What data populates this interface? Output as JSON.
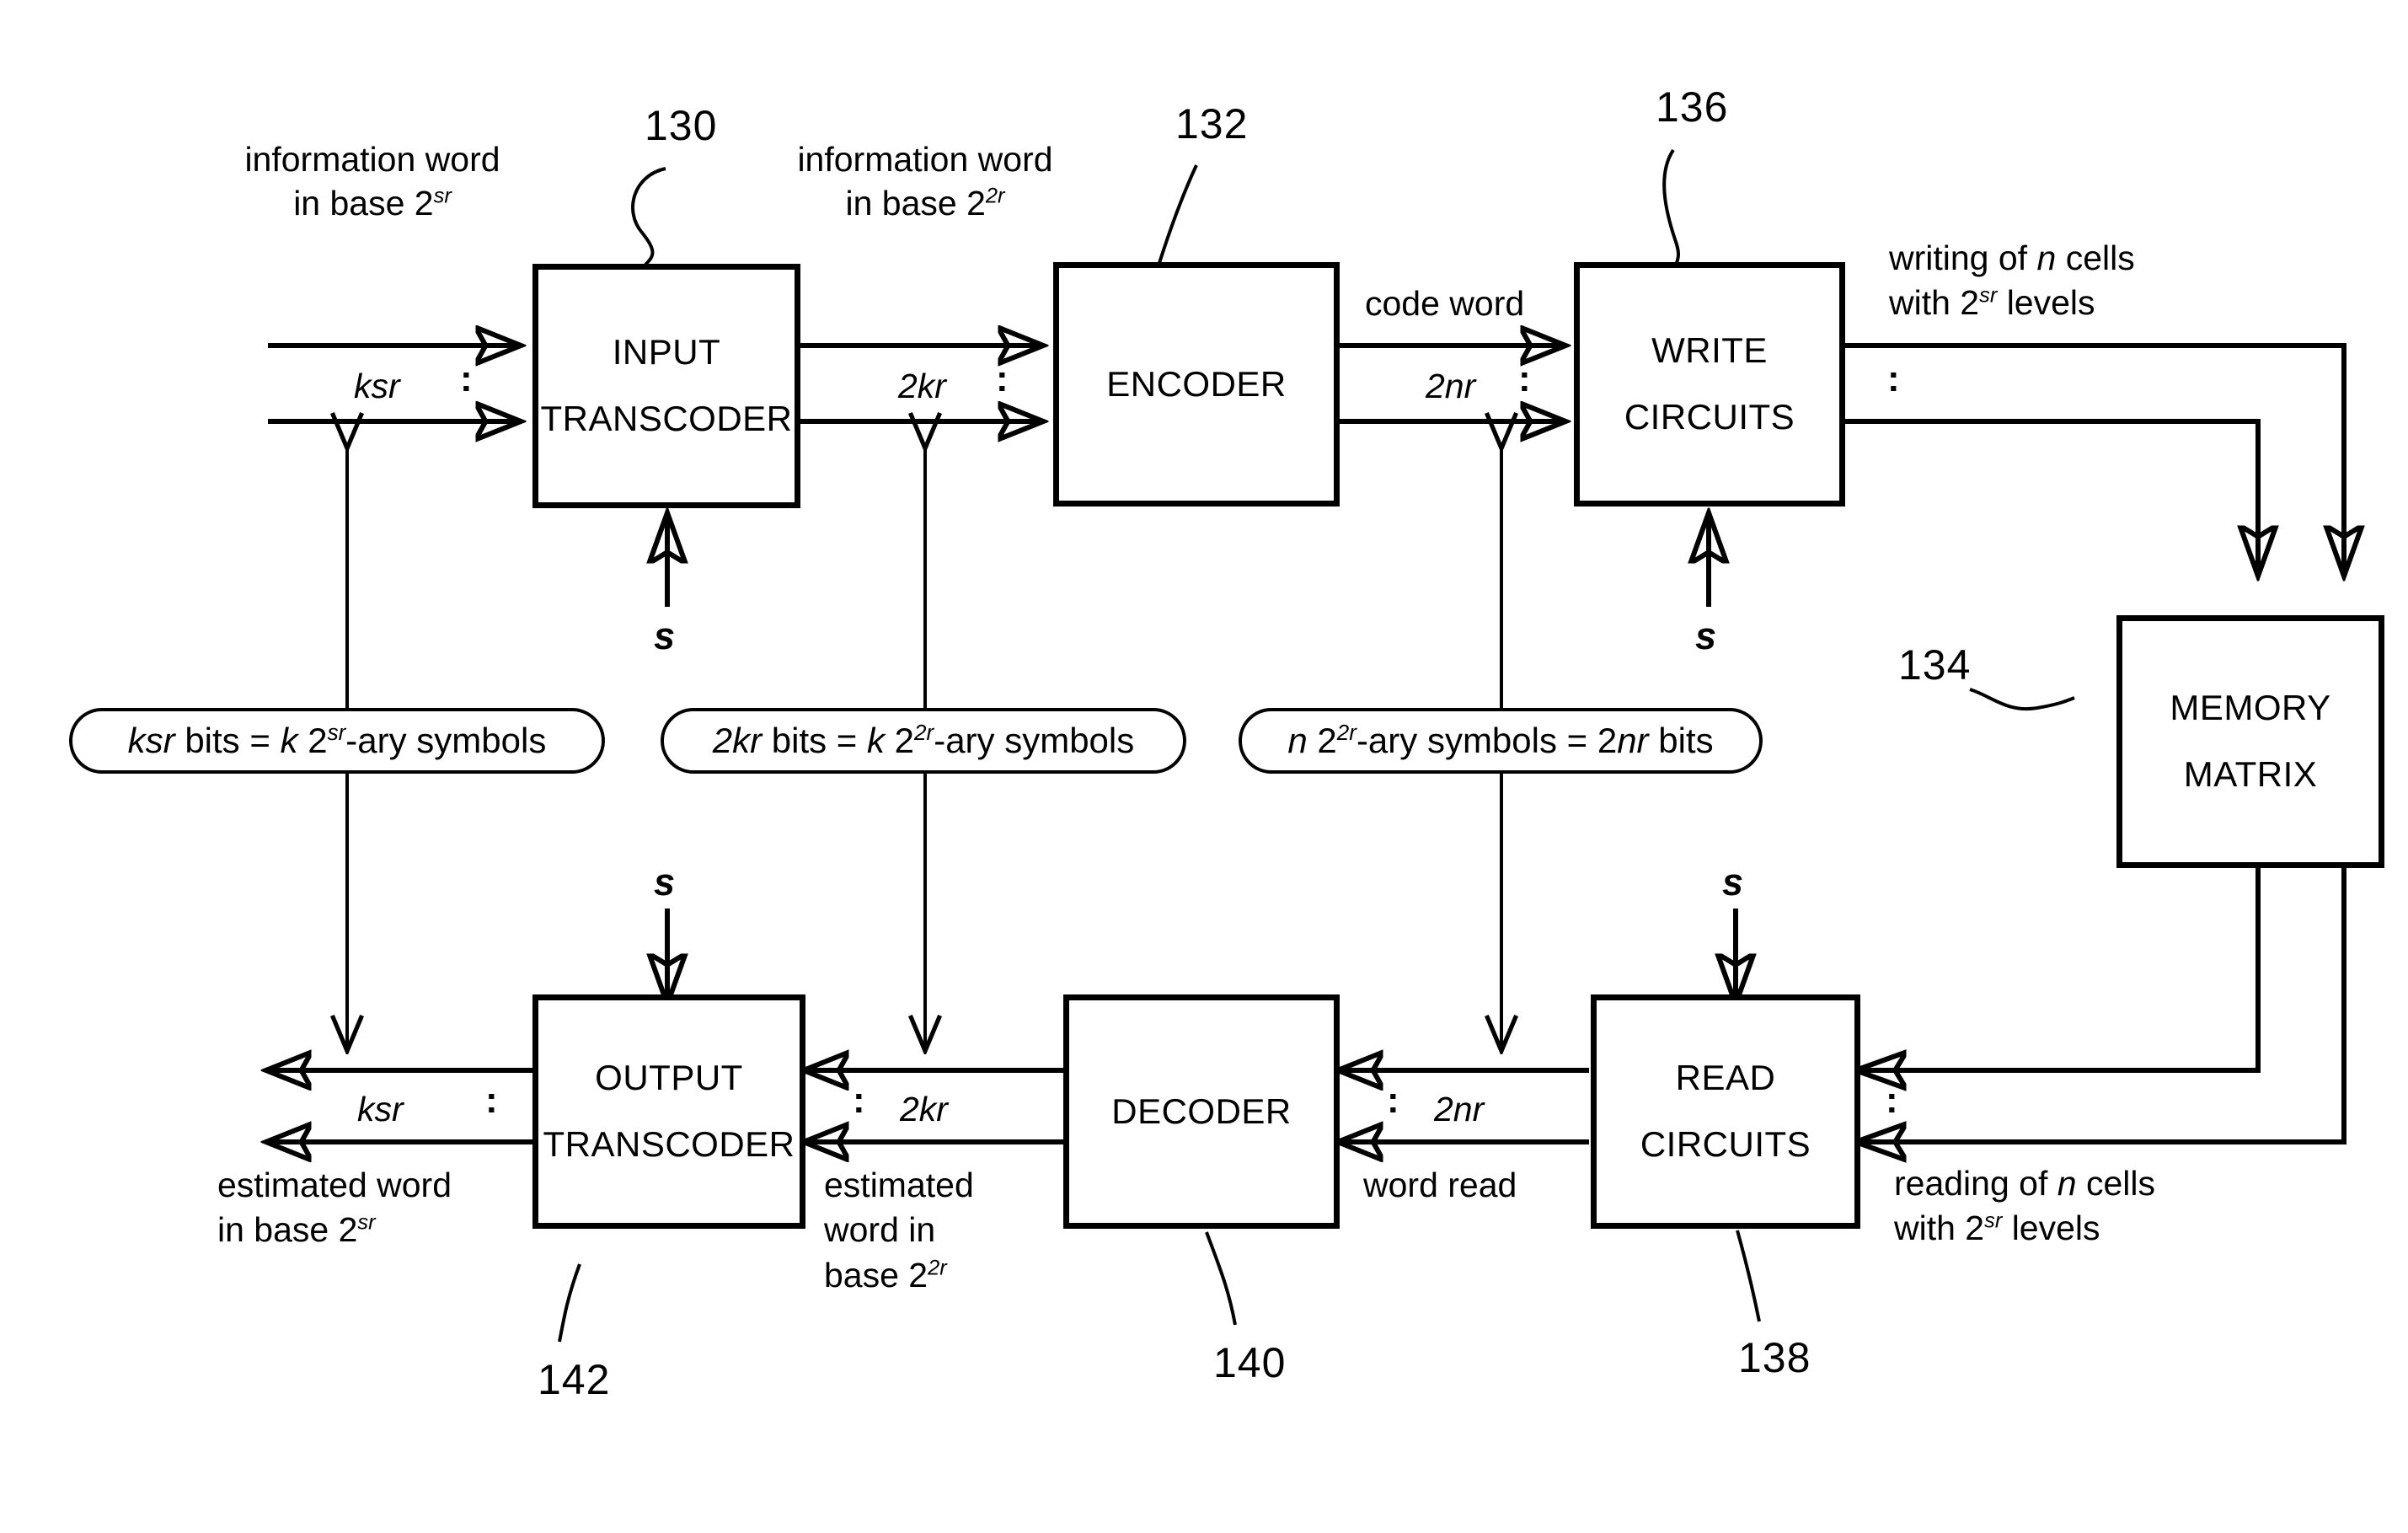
{
  "figure": {
    "type": "block-diagram",
    "title": "Memory coding/decoding block diagram"
  },
  "blocks": [
    {
      "id": "input_transcoder",
      "line1": "INPUT",
      "line2": "TRANSCODER",
      "ref": "130"
    },
    {
      "id": "encoder",
      "line1": "ENCODER",
      "line2": "",
      "ref": "132"
    },
    {
      "id": "write_circuits",
      "line1": "WRITE",
      "line2": "CIRCUITS",
      "ref": "136"
    },
    {
      "id": "memory_matrix",
      "line1": "MEMORY",
      "line2": "MATRIX",
      "ref": "134"
    },
    {
      "id": "read_circuits",
      "line1": "READ",
      "line2": "CIRCUITS",
      "ref": "138"
    },
    {
      "id": "decoder",
      "line1": "DECODER",
      "line2": "",
      "ref": "140"
    },
    {
      "id": "output_transcoder",
      "line1": "OUTPUT",
      "line2": "TRANSCODER",
      "ref": "142"
    }
  ],
  "ref_numbers": {
    "input_transcoder": "130",
    "encoder": "132",
    "memory_matrix": "134",
    "write_circuits": "136",
    "read_circuits": "138",
    "decoder": "140",
    "output_transcoder": "142"
  },
  "annotations": {
    "info_word_sr_l1": "information word",
    "info_word_sr_l2": "in base 2",
    "info_word_sr_sup": "sr",
    "info_word_2r_l1": "information word",
    "info_word_2r_l2": "in base 2",
    "info_word_2r_sup": "2r",
    "code_word": "code word",
    "writing_l1_a": "writing of",
    "writing_l1_b": "n",
    "writing_l1_c": "cells",
    "writing_l2_a": "with 2",
    "writing_l2_sup": "sr",
    "writing_l2_b": "levels",
    "reading_l1_a": "reading of",
    "reading_l1_b": "n",
    "reading_l1_c": "cells",
    "reading_l2_a": "with 2",
    "reading_l2_sup": "sr",
    "reading_l2_b": "levels",
    "word_read": "word read",
    "estimated_word_sr_l1": "estimated word",
    "estimated_word_sr_l2": "in base 2",
    "estimated_word_sr_sup": "sr",
    "estimated_word_2r_l1": "estimated",
    "estimated_word_2r_l2": "word in",
    "estimated_word_2r_l3": "base 2",
    "estimated_word_2r_sup": "2r"
  },
  "bus_labels": {
    "top_ksr": "ksr",
    "top_2kr": "2kr",
    "top_2nr": "2nr",
    "bottom_ksr": "ksr",
    "bottom_2kr": "2kr",
    "bottom_2nr": "2nr",
    "vertical_dots": ":"
  },
  "control_signals": {
    "s_input_transcoder": "s",
    "s_write_circuits": "s",
    "s_output_transcoder": "s",
    "s_read_circuits": "s"
  },
  "pills": [
    {
      "id": "pill_ksr",
      "parts": [
        {
          "text": "ksr",
          "style": "italic"
        },
        {
          "text": " bits =  ",
          "style": "normal"
        },
        {
          "text": "k",
          "style": "italic"
        },
        {
          "text": " 2",
          "style": "normal"
        },
        {
          "text": "sr",
          "style": "sup-italic"
        },
        {
          "text": "-ary symbols",
          "style": "normal"
        }
      ],
      "plain": "ksr bits = k 2sr-ary symbols"
    },
    {
      "id": "pill_2kr",
      "parts": [
        {
          "text": "2kr",
          "style": "italic"
        },
        {
          "text": " bits =  ",
          "style": "normal"
        },
        {
          "text": "k",
          "style": "italic"
        },
        {
          "text": " 2",
          "style": "normal"
        },
        {
          "text": "2r",
          "style": "sup-italic"
        },
        {
          "text": "-ary symbols",
          "style": "normal"
        }
      ],
      "plain": "2kr bits = k 22r-ary symbols"
    },
    {
      "id": "pill_2nr",
      "parts": [
        {
          "text": "n",
          "style": "italic"
        },
        {
          "text": " 2",
          "style": "normal"
        },
        {
          "text": "2r",
          "style": "sup-italic"
        },
        {
          "text": "-ary symbols = 2",
          "style": "normal"
        },
        {
          "text": "nr",
          "style": "italic"
        },
        {
          "text": " bits",
          "style": "normal"
        }
      ],
      "plain": "n 22r-ary symbols = 2nr bits"
    }
  ],
  "colors": {
    "ink": "#000000",
    "paper": "#ffffff"
  }
}
